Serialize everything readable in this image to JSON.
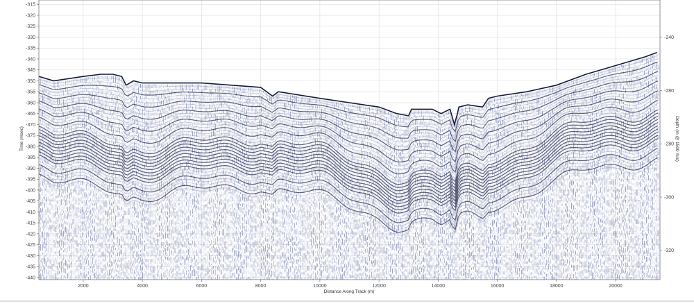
{
  "chart_data": {
    "type": "heatmap",
    "subtype": "seismic-subbottom-profile",
    "xlabel": "Distance Along Track (m)",
    "ylabel_left": "Time (msec)",
    "ylabel_right": "Depth (m @ 1500 m/s)",
    "xlim": [
      500,
      21500
    ],
    "ylim_left": [
      -313,
      -441
    ],
    "ylim_right": [
      -226,
      -331
    ],
    "x_ticks": [
      2000,
      4000,
      6000,
      8000,
      10000,
      12000,
      14000,
      16000,
      18000,
      20000
    ],
    "y_ticks_left": [
      -315,
      -320,
      -325,
      -330,
      -335,
      -340,
      -345,
      -350,
      -355,
      -360,
      -365,
      -370,
      -375,
      -380,
      -385,
      -390,
      -395,
      -400,
      -405,
      -410,
      -415,
      -420,
      -425,
      -430,
      -435,
      -440
    ],
    "y_ticks_right": [
      -240,
      -260,
      -280,
      -300,
      -320
    ],
    "y_tick_labels_right": [
      "-240",
      "-280",
      "-280",
      "-300",
      "-320"
    ],
    "grid": true,
    "seafloor_profile": {
      "x": [
        500,
        1000,
        2000,
        2600,
        3000,
        3300,
        3450,
        3700,
        4000,
        6000,
        8000,
        8400,
        8600,
        10000,
        11000,
        12000,
        12600,
        13000,
        13100,
        13800,
        14100,
        14400,
        14550,
        14650,
        14700,
        15000,
        15500,
        15700,
        16000,
        17000,
        18000,
        19000,
        20000,
        21000,
        21400
      ],
      "y": [
        -348,
        -350,
        -348,
        -347,
        -347,
        -348,
        -352,
        -350,
        -351,
        -351,
        -353,
        -357,
        -355,
        -358,
        -360,
        -362,
        -365,
        -366,
        -363,
        -363,
        -365,
        -363,
        -370,
        -365,
        -362,
        -361,
        -362,
        -358,
        -357,
        -355,
        -352,
        -347,
        -343,
        -339,
        -337
      ]
    },
    "colormap": [
      "#ffffff",
      "#c9cfe6",
      "#6e79a8",
      "#1e2447"
    ]
  }
}
